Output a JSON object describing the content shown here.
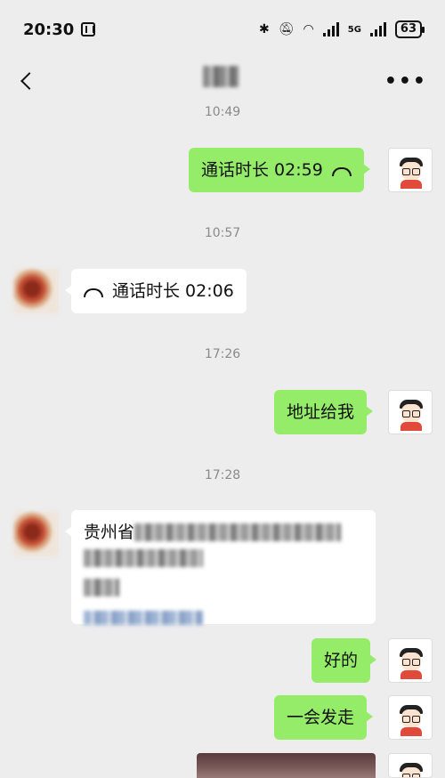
{
  "status_bar": {
    "time": "20:30",
    "network": "5G",
    "battery": "63"
  },
  "nav": {
    "back_icon": "chevron-left-icon",
    "more_label": "•••"
  },
  "messages": {
    "t1": "10:49",
    "call_out": "通话时长 02:59",
    "t2": "10:57",
    "call_in": "通话时长 02:06",
    "t3": "17:26",
    "ask_address": "地址给我",
    "t4": "17:28",
    "address_prefix": "贵州省",
    "ok": "好的",
    "leaving": "一会发走"
  },
  "colors": {
    "my_bubble": "#95ec69",
    "other_bubble": "#ffffff",
    "background": "#ededed"
  }
}
